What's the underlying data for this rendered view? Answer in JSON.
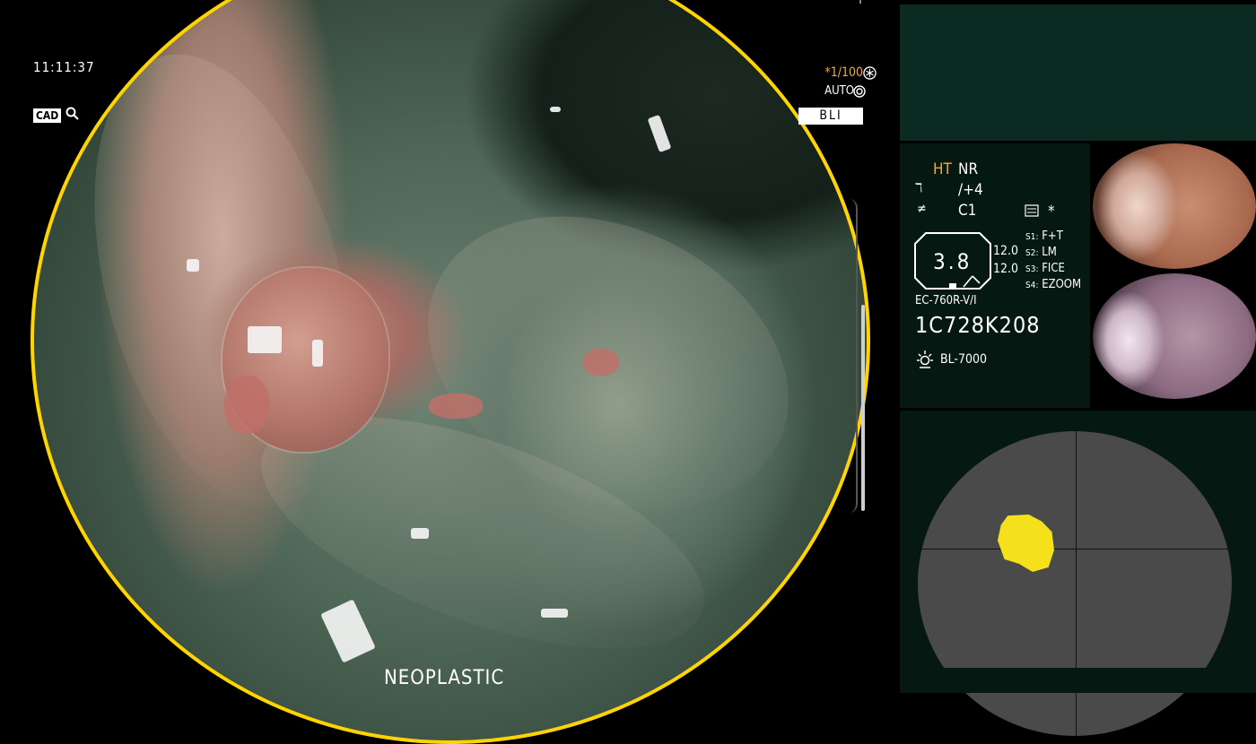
{
  "overlay": {
    "clock": "11:11:37",
    "cad_label": "CAD",
    "shutter": "*1/100",
    "auto_label": "AUTO",
    "mode_label": "BLI",
    "diagnosis": "NEOPLASTIC"
  },
  "info_panel": {
    "ht": "HT",
    "nr": "NR",
    "enhance_value": "/+4",
    "color_value": "C1",
    "star": "*",
    "zoom_value": "3.8",
    "left_values": [
      "12.0",
      "12.0"
    ],
    "switches": [
      {
        "key": "S1",
        "value": "F+T"
      },
      {
        "key": "S2",
        "value": "LM"
      },
      {
        "key": "S3",
        "value": "FICE"
      },
      {
        "key": "S4",
        "value": "EZOOM"
      }
    ],
    "scope_model": "EC-760R-V/I",
    "serial": "1C728K208",
    "light_source": "BL-7000"
  },
  "colors": {
    "frame": "#ffd400",
    "ht_accent": "#f0b028",
    "lesion_marker": "#f4e11c",
    "panel_bg": "#0b2a22"
  },
  "icons": {
    "cad": "search-icon",
    "shutter": "snowflake-icon",
    "auto": "aperture-icon",
    "light": "sun-icon"
  }
}
